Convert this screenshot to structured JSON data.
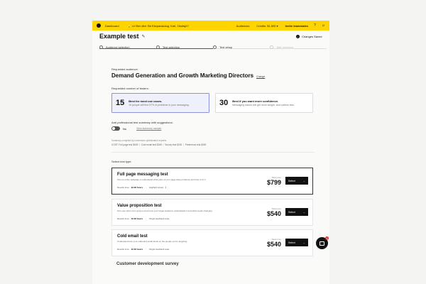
{
  "topbar": {
    "dashboard": "Dashboard",
    "promo": "💡 Le Blvr dire: Bir Ekspansiolog, Karl, Oksilsjö?",
    "audiences": "Audiences",
    "credits": "Credits: $1,500 ▾",
    "invite": "Invite teammates",
    "accent_color": "#ffd400"
  },
  "header": {
    "title": "Example test",
    "saved": "Changes Saved"
  },
  "steps": [
    {
      "label": "Audience selection"
    },
    {
      "label": "Test selection"
    },
    {
      "label": "Test setup"
    },
    {
      "label": "Test overview"
    }
  ],
  "audience": {
    "requested_label": "Requested audience:",
    "name": "Demand Generation and Growth Marketing Directors",
    "change": "Change"
  },
  "testers": {
    "label": "Requested number of testers:",
    "options": [
      {
        "count": "15",
        "title": "Best for most use cases.",
        "subtitle": "15 people will find 97% of problems in your messaging."
      },
      {
        "count": "30",
        "title": "Best if you want more confidence.",
        "subtitle": "Messaging issues will get more weight, and outliers less."
      }
    ]
  },
  "suggestions": {
    "label": "Add professional test summary with suggestions:",
    "toggle_value": "No",
    "view_link": "View summary sample",
    "note": "Summary compiled by conversion optimization experts.",
    "costs": [
      "COST: Full page test $549",
      "Cold email test $349",
      "Survey test $249",
      "Preference test $349"
    ]
  },
  "tests": {
    "label": "Select test type:",
    "items": [
      {
        "name": "Full page messaging test",
        "desc": "Test an entire webpage to understand what parts of your page have problems and how to fix it",
        "results_label": "Results time:",
        "results_time": "12-48 hours",
        "extra": "Highlight areas",
        "price_label": "Total price",
        "price": "$799",
        "button": "Select"
      },
      {
        "name": "Value proposition test",
        "desc": "Test your site's hero area to know how your target audience understands it and what needs changing",
        "results_label": "Results time:",
        "results_time": "12-48 hours",
        "extra": "Single feedback area",
        "price_label": "Total price",
        "price": "$540",
        "button": "Select"
      },
      {
        "name": "Cold email test",
        "desc": "Understand how your outbound email lands on the people you're targeting",
        "results_label": "Results time:",
        "results_time": "12-48 hours",
        "extra": "Single feedback area",
        "price_label": "Total price",
        "price": "$540",
        "button": "Select"
      }
    ],
    "partial_next": "Customer development survey"
  },
  "chat": {
    "badge": "1"
  }
}
